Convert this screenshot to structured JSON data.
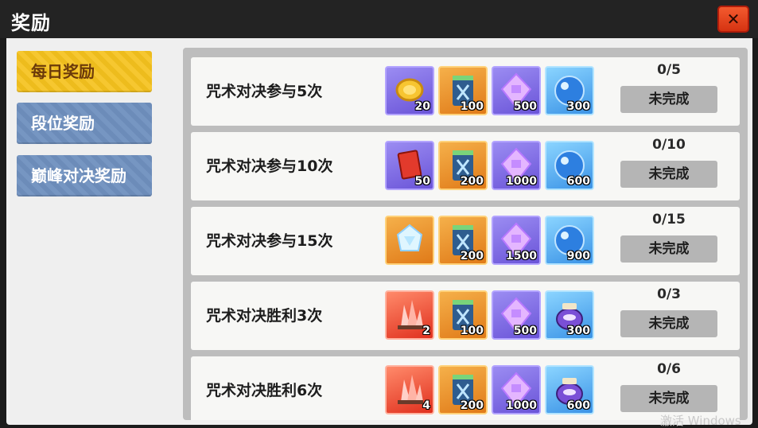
{
  "window": {
    "title": "奖励"
  },
  "sidebar": {
    "tabs": [
      {
        "label": "每日奖励",
        "active": true
      },
      {
        "label": "段位奖励",
        "active": false
      },
      {
        "label": "巅峰对决奖励",
        "active": false
      }
    ]
  },
  "tasks": [
    {
      "name": "咒术对决参与5次",
      "progress": "0/5",
      "status": "未完成",
      "rewards": [
        {
          "icon": "gold-coin-icon",
          "qty": "20"
        },
        {
          "icon": "ticket-icon",
          "qty": "100"
        },
        {
          "icon": "purple-crystal-icon",
          "qty": "500"
        },
        {
          "icon": "blue-orb-icon",
          "qty": "300"
        }
      ]
    },
    {
      "name": "咒术对决参与10次",
      "progress": "0/10",
      "status": "未完成",
      "rewards": [
        {
          "icon": "red-book-icon",
          "qty": "50"
        },
        {
          "icon": "ticket-icon",
          "qty": "200"
        },
        {
          "icon": "purple-crystal-icon",
          "qty": "1000"
        },
        {
          "icon": "blue-orb-icon",
          "qty": "600"
        }
      ]
    },
    {
      "name": "咒术对决参与15次",
      "progress": "0/15",
      "status": "未完成",
      "rewards": [
        {
          "icon": "rainbow-crystal-icon",
          "qty": ""
        },
        {
          "icon": "ticket-icon",
          "qty": "200"
        },
        {
          "icon": "purple-crystal-icon",
          "qty": "1500"
        },
        {
          "icon": "blue-orb-icon",
          "qty": "900"
        }
      ]
    },
    {
      "name": "咒术对决胜利3次",
      "progress": "0/3",
      "status": "未完成",
      "rewards": [
        {
          "icon": "red-gem-cluster-icon",
          "qty": "2"
        },
        {
          "icon": "ticket-icon",
          "qty": "100"
        },
        {
          "icon": "purple-crystal-icon",
          "qty": "500"
        },
        {
          "icon": "purple-jar-icon",
          "qty": "300"
        }
      ]
    },
    {
      "name": "咒术对决胜利6次",
      "progress": "0/6",
      "status": "未完成",
      "rewards": [
        {
          "icon": "red-gem-cluster-icon",
          "qty": "4"
        },
        {
          "icon": "ticket-icon",
          "qty": "200"
        },
        {
          "icon": "purple-crystal-icon",
          "qty": "1000"
        },
        {
          "icon": "purple-jar-icon",
          "qty": "600"
        }
      ]
    }
  ],
  "watermark": "激活 Windows",
  "colors": {
    "accent": "#f5c21e",
    "tab": "#6f90bf",
    "close": "#e8441c"
  }
}
